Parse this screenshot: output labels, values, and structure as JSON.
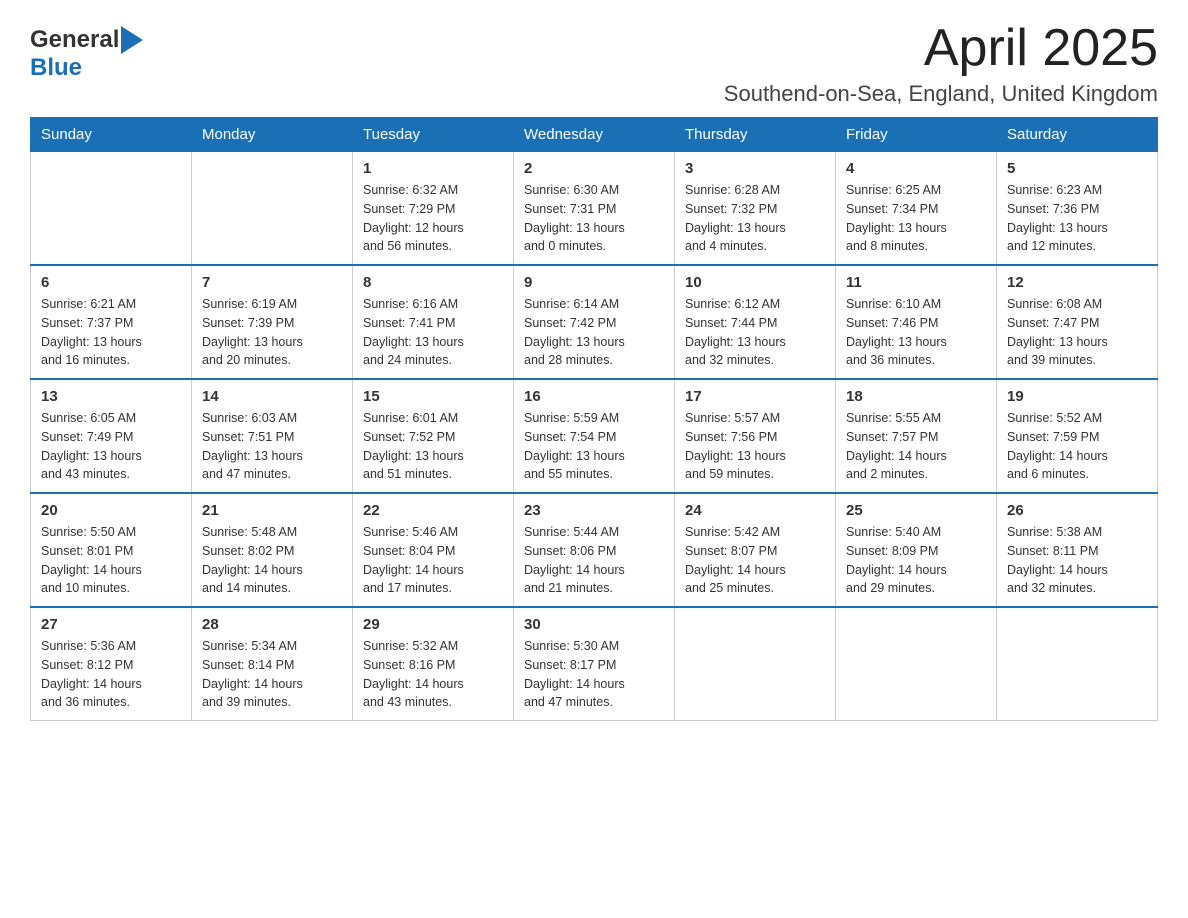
{
  "header": {
    "title": "April 2025",
    "subtitle": "Southend-on-Sea, England, United Kingdom",
    "logo_general": "General",
    "logo_blue": "Blue"
  },
  "days_of_week": [
    "Sunday",
    "Monday",
    "Tuesday",
    "Wednesday",
    "Thursday",
    "Friday",
    "Saturday"
  ],
  "weeks": [
    [
      {
        "day": "",
        "info": ""
      },
      {
        "day": "",
        "info": ""
      },
      {
        "day": "1",
        "info": "Sunrise: 6:32 AM\nSunset: 7:29 PM\nDaylight: 12 hours\nand 56 minutes."
      },
      {
        "day": "2",
        "info": "Sunrise: 6:30 AM\nSunset: 7:31 PM\nDaylight: 13 hours\nand 0 minutes."
      },
      {
        "day": "3",
        "info": "Sunrise: 6:28 AM\nSunset: 7:32 PM\nDaylight: 13 hours\nand 4 minutes."
      },
      {
        "day": "4",
        "info": "Sunrise: 6:25 AM\nSunset: 7:34 PM\nDaylight: 13 hours\nand 8 minutes."
      },
      {
        "day": "5",
        "info": "Sunrise: 6:23 AM\nSunset: 7:36 PM\nDaylight: 13 hours\nand 12 minutes."
      }
    ],
    [
      {
        "day": "6",
        "info": "Sunrise: 6:21 AM\nSunset: 7:37 PM\nDaylight: 13 hours\nand 16 minutes."
      },
      {
        "day": "7",
        "info": "Sunrise: 6:19 AM\nSunset: 7:39 PM\nDaylight: 13 hours\nand 20 minutes."
      },
      {
        "day": "8",
        "info": "Sunrise: 6:16 AM\nSunset: 7:41 PM\nDaylight: 13 hours\nand 24 minutes."
      },
      {
        "day": "9",
        "info": "Sunrise: 6:14 AM\nSunset: 7:42 PM\nDaylight: 13 hours\nand 28 minutes."
      },
      {
        "day": "10",
        "info": "Sunrise: 6:12 AM\nSunset: 7:44 PM\nDaylight: 13 hours\nand 32 minutes."
      },
      {
        "day": "11",
        "info": "Sunrise: 6:10 AM\nSunset: 7:46 PM\nDaylight: 13 hours\nand 36 minutes."
      },
      {
        "day": "12",
        "info": "Sunrise: 6:08 AM\nSunset: 7:47 PM\nDaylight: 13 hours\nand 39 minutes."
      }
    ],
    [
      {
        "day": "13",
        "info": "Sunrise: 6:05 AM\nSunset: 7:49 PM\nDaylight: 13 hours\nand 43 minutes."
      },
      {
        "day": "14",
        "info": "Sunrise: 6:03 AM\nSunset: 7:51 PM\nDaylight: 13 hours\nand 47 minutes."
      },
      {
        "day": "15",
        "info": "Sunrise: 6:01 AM\nSunset: 7:52 PM\nDaylight: 13 hours\nand 51 minutes."
      },
      {
        "day": "16",
        "info": "Sunrise: 5:59 AM\nSunset: 7:54 PM\nDaylight: 13 hours\nand 55 minutes."
      },
      {
        "day": "17",
        "info": "Sunrise: 5:57 AM\nSunset: 7:56 PM\nDaylight: 13 hours\nand 59 minutes."
      },
      {
        "day": "18",
        "info": "Sunrise: 5:55 AM\nSunset: 7:57 PM\nDaylight: 14 hours\nand 2 minutes."
      },
      {
        "day": "19",
        "info": "Sunrise: 5:52 AM\nSunset: 7:59 PM\nDaylight: 14 hours\nand 6 minutes."
      }
    ],
    [
      {
        "day": "20",
        "info": "Sunrise: 5:50 AM\nSunset: 8:01 PM\nDaylight: 14 hours\nand 10 minutes."
      },
      {
        "day": "21",
        "info": "Sunrise: 5:48 AM\nSunset: 8:02 PM\nDaylight: 14 hours\nand 14 minutes."
      },
      {
        "day": "22",
        "info": "Sunrise: 5:46 AM\nSunset: 8:04 PM\nDaylight: 14 hours\nand 17 minutes."
      },
      {
        "day": "23",
        "info": "Sunrise: 5:44 AM\nSunset: 8:06 PM\nDaylight: 14 hours\nand 21 minutes."
      },
      {
        "day": "24",
        "info": "Sunrise: 5:42 AM\nSunset: 8:07 PM\nDaylight: 14 hours\nand 25 minutes."
      },
      {
        "day": "25",
        "info": "Sunrise: 5:40 AM\nSunset: 8:09 PM\nDaylight: 14 hours\nand 29 minutes."
      },
      {
        "day": "26",
        "info": "Sunrise: 5:38 AM\nSunset: 8:11 PM\nDaylight: 14 hours\nand 32 minutes."
      }
    ],
    [
      {
        "day": "27",
        "info": "Sunrise: 5:36 AM\nSunset: 8:12 PM\nDaylight: 14 hours\nand 36 minutes."
      },
      {
        "day": "28",
        "info": "Sunrise: 5:34 AM\nSunset: 8:14 PM\nDaylight: 14 hours\nand 39 minutes."
      },
      {
        "day": "29",
        "info": "Sunrise: 5:32 AM\nSunset: 8:16 PM\nDaylight: 14 hours\nand 43 minutes."
      },
      {
        "day": "30",
        "info": "Sunrise: 5:30 AM\nSunset: 8:17 PM\nDaylight: 14 hours\nand 47 minutes."
      },
      {
        "day": "",
        "info": ""
      },
      {
        "day": "",
        "info": ""
      },
      {
        "day": "",
        "info": ""
      }
    ]
  ]
}
